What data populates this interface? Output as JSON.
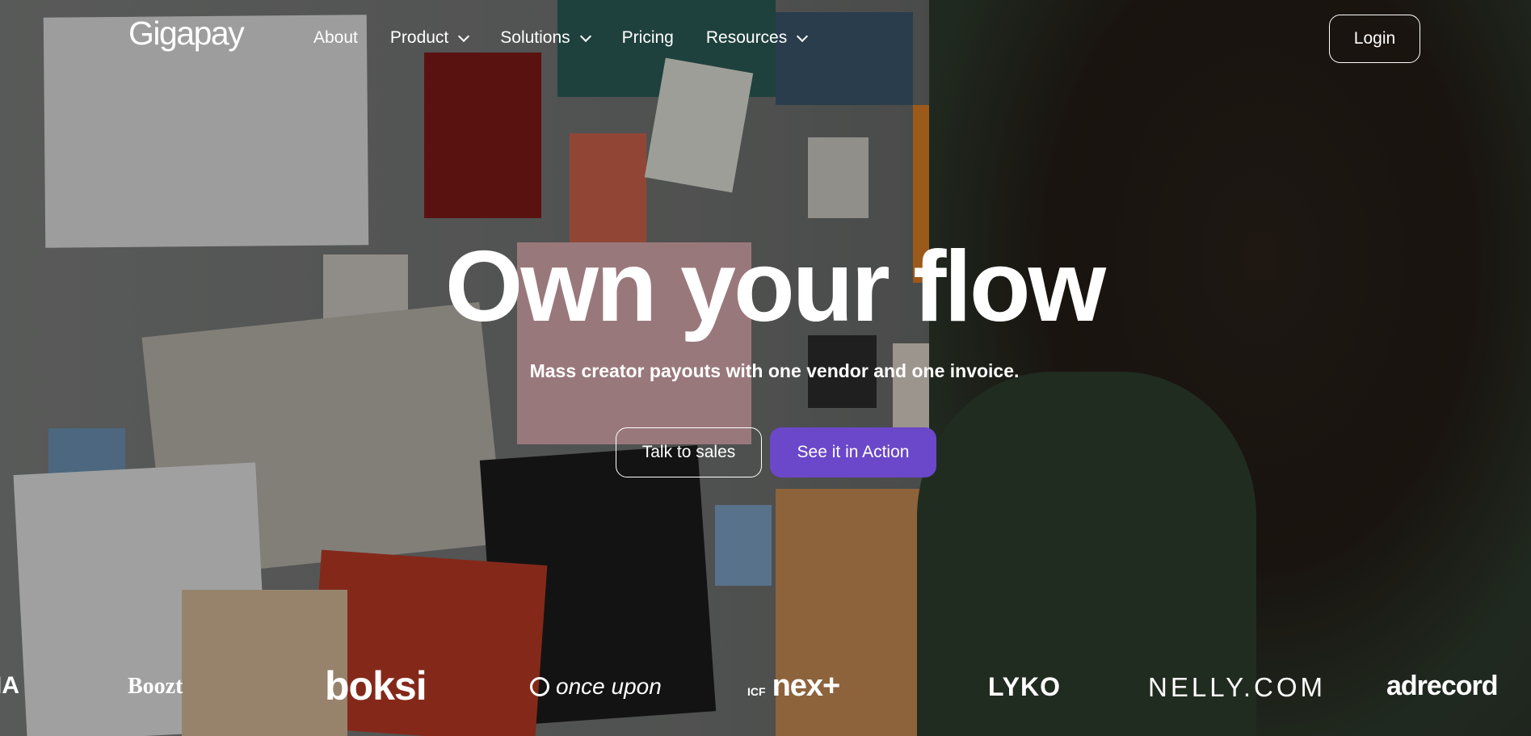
{
  "header": {
    "logo": "Gigapay",
    "nav": [
      {
        "label": "About",
        "has_dropdown": false
      },
      {
        "label": "Product",
        "has_dropdown": true
      },
      {
        "label": "Solutions",
        "has_dropdown": true
      },
      {
        "label": "Pricing",
        "has_dropdown": false
      },
      {
        "label": "Resources",
        "has_dropdown": true
      }
    ],
    "login_label": "Login"
  },
  "hero": {
    "title": "Own your flow",
    "subtitle": "Mass creator payouts with one vendor and one invoice.",
    "cta_secondary": "Talk to sales",
    "cta_primary": "See it in Action"
  },
  "brands": {
    "partial": "IA",
    "boozt": "Boozt",
    "boksi": "boksi",
    "once_upon": "once upon",
    "icf": "ICF",
    "nextplus": "nex+",
    "lyko": "LYKO",
    "nelly": "NELLY.COM",
    "adrecord": "adrecord"
  },
  "colors": {
    "primary_button": "#6b47c9",
    "text": "#ffffff"
  }
}
